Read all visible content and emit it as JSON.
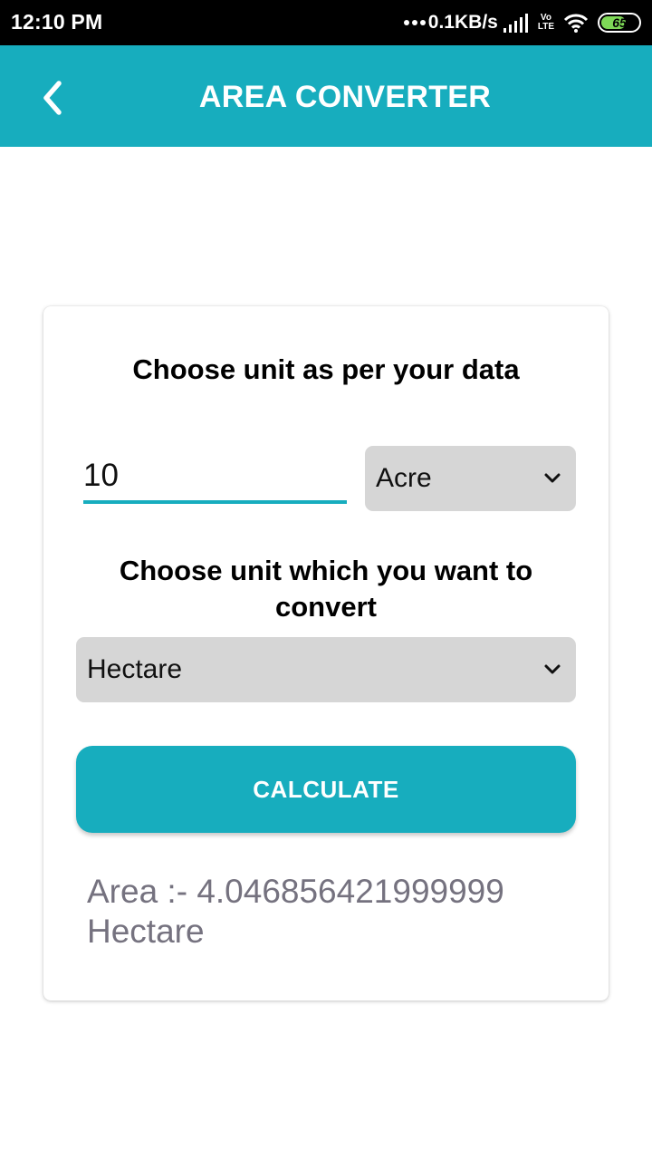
{
  "status_bar": {
    "time": "12:10 PM",
    "net_speed": "0.1KB/s",
    "volte_top": "Vo",
    "volte_bottom": "LTE",
    "battery_level": "65",
    "icons": [
      "dots-icon",
      "signal-icon",
      "volte-icon",
      "wifi-icon",
      "battery-icon"
    ]
  },
  "app_bar": {
    "title": "AREA CONVERTER",
    "back_icon": "chevron-left-icon",
    "color": "#17adbe"
  },
  "form": {
    "heading_from": "Choose unit as per your data",
    "input_value": "10",
    "from_unit": "Acre",
    "heading_to": "Choose unit which you want to convert",
    "to_unit": "Hectare",
    "calculate_label": "CALCULATE",
    "result": "Area :- 4.046856421999999 Hectare",
    "dropdown_icon": "chevron-down-icon"
  },
  "colors": {
    "accent": "#17adbe",
    "select_bg": "#d6d6d6",
    "result_text": "#75727f"
  }
}
